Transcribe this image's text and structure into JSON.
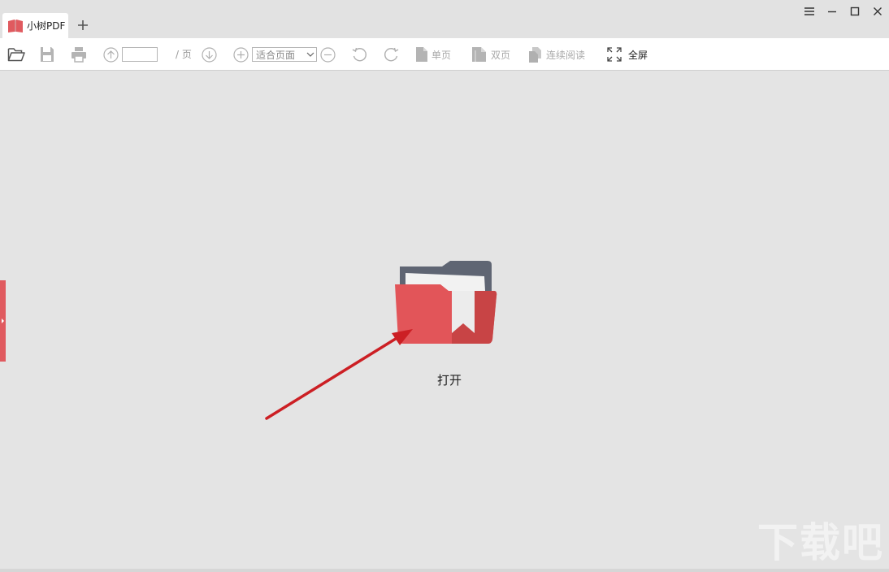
{
  "app": {
    "tab_title": "小树PDF",
    "brand_color": "#e05a5f"
  },
  "window_controls": [
    "menu-icon",
    "minimize-icon",
    "maximize-icon",
    "close-icon"
  ],
  "toolbar": {
    "page_input_value": "",
    "page_separator": "/ 页",
    "zoom_value": "适合页面",
    "single_page_label": "单页",
    "double_page_label": "双页",
    "continuous_label": "连续阅读",
    "fullscreen_label": "全屏"
  },
  "main": {
    "open_label": "打开",
    "folder_colors": {
      "back": "#5f6573",
      "front": "#e25559",
      "front_dark": "#c84445",
      "paper": "#f2f2f2"
    },
    "annotation_arrow_color": "#cc1f24"
  },
  "watermark": {
    "text": "下载吧"
  }
}
